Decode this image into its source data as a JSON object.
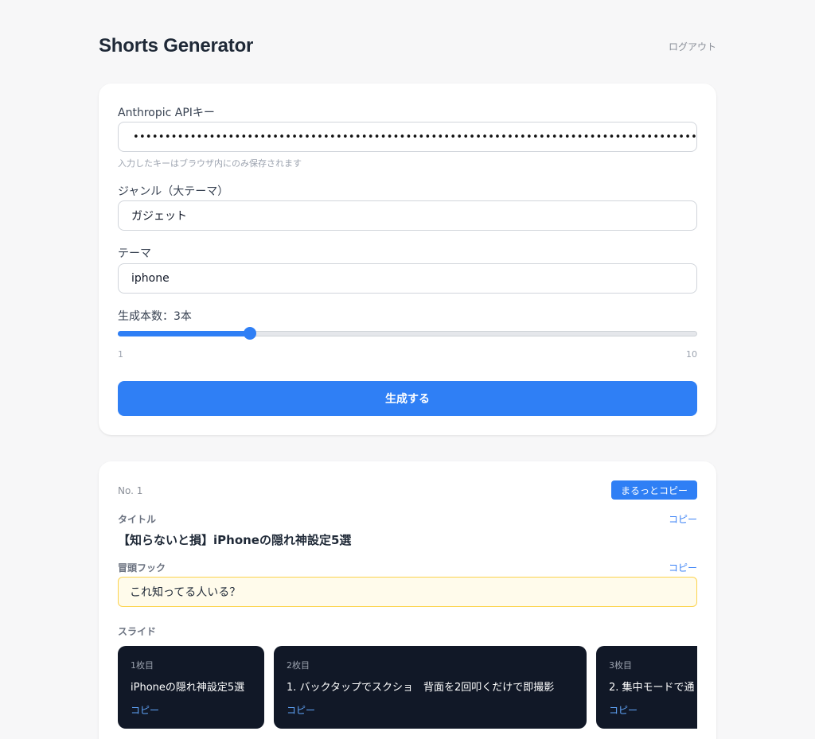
{
  "header": {
    "title": "Shorts Generator",
    "logout": "ログアウト"
  },
  "form": {
    "api_key": {
      "label": "Anthropic APIキー",
      "value": "••••••••••••••••••••••••••••••••••••••••••••••••••••••••••••••••••••••••••••••••••••••••••••••••••••••••••",
      "hint": "入力したキーはブラウザ内にのみ保存されます"
    },
    "genre": {
      "label": "ジャンル（大テーマ）",
      "value": "ガジェット"
    },
    "theme": {
      "label": "テーマ",
      "value": "iphone"
    },
    "count": {
      "label": "生成本数：3本",
      "value": 3,
      "min": 1,
      "max": 10,
      "min_label": "1",
      "max_label": "10"
    },
    "submit": "生成する"
  },
  "result": {
    "number": "No. 1",
    "copy_all": "まるっとコピー",
    "title_label": "タイトル",
    "title": "【知らないと損】iPhoneの隠れ神設定5選",
    "hook_label": "冒頭フック",
    "hook": "これ知ってる人いる？",
    "slides_label": "スライド",
    "copy": "コピー",
    "slides": [
      {
        "num": "1枚目",
        "text": "iPhoneの隠れ神設定5選",
        "copy": "コピー"
      },
      {
        "num": "2枚目",
        "text": "1. バックタップでスクショ　背面を2回叩くだけで即撮影",
        "copy": "コピー"
      },
      {
        "num": "3枚目",
        "text": "2. 集中モードで通",
        "copy": "コピー"
      }
    ]
  },
  "colors": {
    "accent": "#2f7ff5",
    "slide_bg": "#111827",
    "hook_bg": "#fffbeb",
    "hook_border": "#fcd34d"
  }
}
